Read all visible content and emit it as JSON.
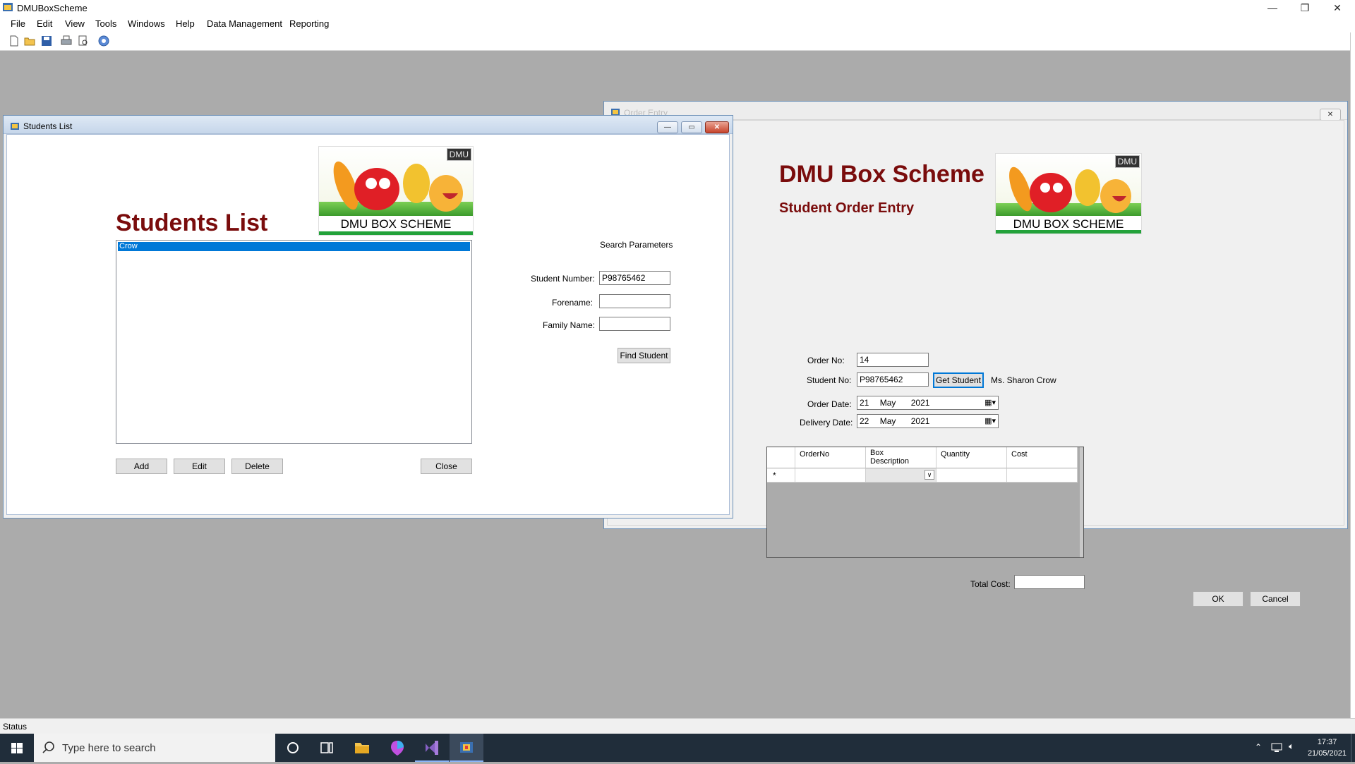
{
  "app": {
    "title": "DMUBoxScheme",
    "caption_buttons": {
      "minimize": "—",
      "restore": "❐",
      "close": "✕"
    }
  },
  "menu": [
    "File",
    "Edit",
    "View",
    "Tools",
    "Windows",
    "Help",
    "Data Management",
    "Reporting"
  ],
  "toolbar": [
    "new-icon",
    "open-icon",
    "save-icon",
    "print-icon",
    "print-preview-icon",
    "help-icon"
  ],
  "status": {
    "text": "Status"
  },
  "students_window": {
    "title": "Students List",
    "heading": "Students List",
    "logo": {
      "banner": "DMU BOX SCHEME",
      "tag": "DMU"
    },
    "list_items": [
      "Crow"
    ],
    "search": {
      "caption": "Search Parameters",
      "student_number_label": "Student Number:",
      "student_number_value": "P98765462",
      "forename_label": "Forename:",
      "forename_value": "",
      "family_name_label": "Family Name:",
      "family_name_value": "",
      "find_button": "Find Student"
    },
    "buttons": {
      "add": "Add",
      "edit": "Edit",
      "delete": "Delete",
      "close": "Close"
    }
  },
  "order_window": {
    "title": "Order Entry",
    "heading": "DMU Box Scheme",
    "subheading": "Student Order Entry",
    "logo": {
      "banner": "DMU BOX SCHEME",
      "tag": "DMU"
    },
    "order_no_label": "Order No:",
    "order_no_value": "14",
    "student_no_label": "Student No:",
    "student_no_value": "P98765462",
    "get_student_button": "Get Student",
    "student_name": "Ms. Sharon Crow",
    "order_date_label": "Order Date:",
    "order_date": {
      "day": "21",
      "month": "May",
      "year": "2021"
    },
    "delivery_date_label": "Delivery Date:",
    "delivery_date": {
      "day": "22",
      "month": "May",
      "year": "2021"
    },
    "grid": {
      "columns": [
        "OrderNo",
        "Box\nDescription",
        "Quantity",
        "Cost"
      ],
      "new_row_marker": "*"
    },
    "total_cost_label": "Total Cost:",
    "total_cost_value": "",
    "ok_button": "OK",
    "cancel_button": "Cancel"
  },
  "taskbar": {
    "search_placeholder": "Type here to search",
    "time": "17:37",
    "date": "21/05/2021"
  }
}
